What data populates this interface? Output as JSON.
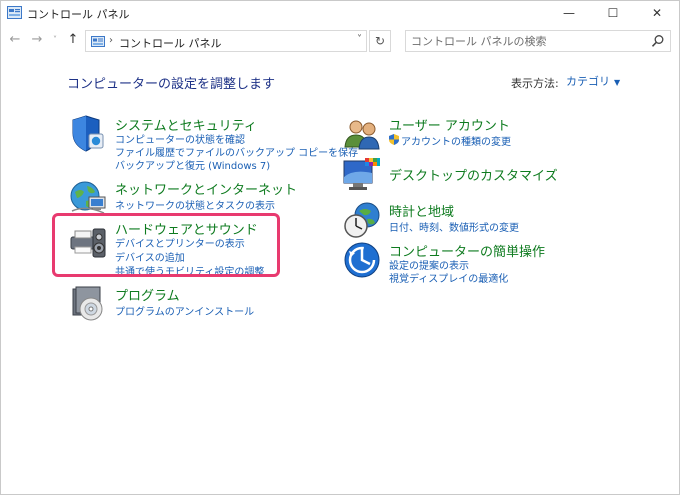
{
  "window": {
    "title": "コントロール パネル",
    "controls": {
      "minimize": "—",
      "maximize": "☐",
      "close": "✕"
    }
  },
  "nav": {
    "back": "←",
    "forward": "→",
    "recent": "˅",
    "up": "↑",
    "breadcrumb_sep": "›",
    "breadcrumb": "コントロール パネル",
    "address_dropdown": "˅",
    "refresh": "↻",
    "search_placeholder": "コントロール パネルの検索"
  },
  "main": {
    "heading": "コンピューターの設定を調整します",
    "view_by_label": "表示方法:",
    "view_by_value": "カテゴリ",
    "view_by_arrow": "▼"
  },
  "categories_left": [
    {
      "title": "システムとセキュリティ",
      "links": [
        "コンピューターの状態を確認",
        "ファイル履歴でファイルのバックアップ コピーを保存",
        "バックアップと復元 (Windows 7)"
      ]
    },
    {
      "title": "ネットワークとインターネット",
      "links": [
        "ネットワークの状態とタスクの表示"
      ]
    },
    {
      "title": "ハードウェアとサウンド",
      "links": [
        "デバイスとプリンターの表示",
        "デバイスの追加",
        "共通で使うモビリティ設定の調整"
      ]
    },
    {
      "title": "プログラム",
      "links": [
        "プログラムのアンインストール"
      ]
    }
  ],
  "categories_right": [
    {
      "title": "ユーザー アカウント",
      "links": [
        "アカウントの種類の変更"
      ]
    },
    {
      "title": "デスクトップのカスタマイズ",
      "links": []
    },
    {
      "title": "時計と地域",
      "links": [
        "日付、時刻、数値形式の変更"
      ]
    },
    {
      "title": "コンピューターの簡単操作",
      "links": [
        "設定の提案の表示",
        "視覚ディスプレイの最適化"
      ]
    }
  ],
  "icons": {
    "system": "shield-icon",
    "network": "globe-network-icon",
    "hardware": "printer-speaker-icon",
    "programs": "programs-disc-icon",
    "users": "users-icon",
    "desktop": "desktop-icon",
    "clock": "clock-globe-icon",
    "access": "ease-of-access-icon",
    "uac": "uac-shield-icon"
  },
  "colors": {
    "heading": "#1e3287",
    "category_title": "#0e7b1f",
    "link": "#1a5fb4",
    "highlight": "#e83a6f"
  }
}
